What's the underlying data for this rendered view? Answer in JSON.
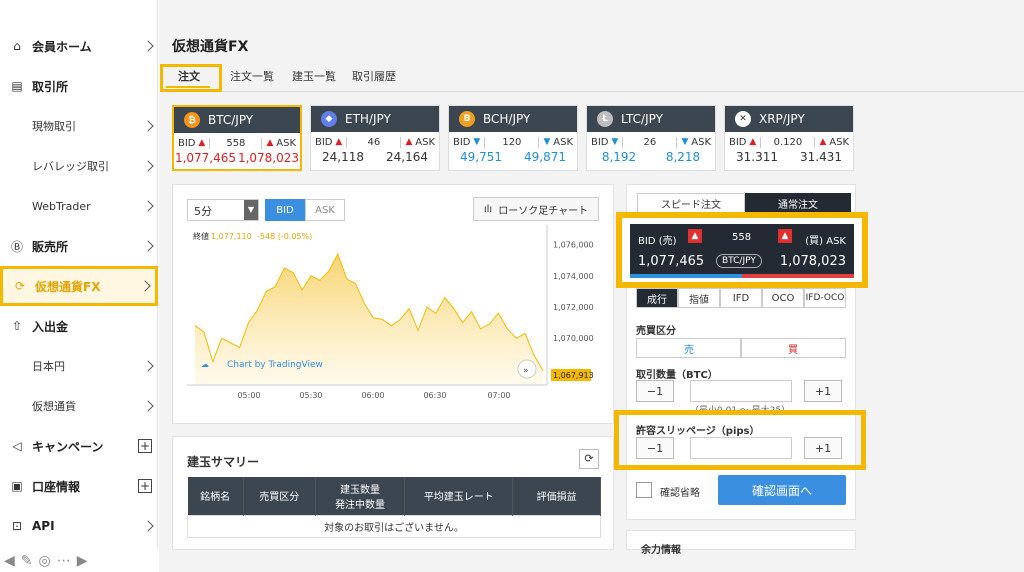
{
  "sidebar": {
    "items": [
      {
        "label": "会員ホーム",
        "icon": "home-icon",
        "glyph": "⌂",
        "control": "chevron"
      },
      {
        "label": "取引所",
        "icon": "building-icon",
        "glyph": "▤",
        "control": "none"
      },
      {
        "label": "現物取引",
        "icon": "",
        "glyph": "",
        "control": "chevron"
      },
      {
        "label": "レバレッジ取引",
        "icon": "",
        "glyph": "",
        "control": "chevron"
      },
      {
        "label": "WebTrader",
        "icon": "",
        "glyph": "",
        "control": "chevron"
      },
      {
        "label": "販売所",
        "icon": "bitcoin-icon",
        "glyph": "Ⓑ",
        "control": "chevron"
      },
      {
        "label": "仮想通貨FX",
        "icon": "exchange-icon",
        "glyph": "⟳",
        "control": "chevron"
      },
      {
        "label": "入出金",
        "icon": "deposit-icon",
        "glyph": "⇧",
        "control": "none"
      },
      {
        "label": "日本円",
        "icon": "",
        "glyph": "",
        "control": "chevron"
      },
      {
        "label": "仮想通貨",
        "icon": "",
        "glyph": "",
        "control": "chevron"
      },
      {
        "label": "キャンペーン",
        "icon": "megaphone-icon",
        "glyph": "◁",
        "control": "plus"
      },
      {
        "label": "口座情報",
        "icon": "id-card-icon",
        "glyph": "▣",
        "control": "plus"
      },
      {
        "label": "API",
        "icon": "api-icon",
        "glyph": "⊡",
        "control": "chevron"
      }
    ]
  },
  "page": {
    "title": "仮想通貨FX"
  },
  "tabs": [
    {
      "label": "注文"
    },
    {
      "label": "注文一覧"
    },
    {
      "label": "建玉一覧"
    },
    {
      "label": "取引履歴"
    }
  ],
  "pairs": [
    {
      "name": "BTC/JPY",
      "coin_color": "#f7931a",
      "coin_glyph": "₿",
      "bid_label": "BID",
      "ask_label": "ASK",
      "spread": "558",
      "bid": "1,077,465",
      "ask": "1,078,023",
      "bid_dir": "up",
      "ask_dir": "up"
    },
    {
      "name": "ETH/JPY",
      "coin_color": "#627eea",
      "coin_glyph": "◆",
      "bid_label": "BID",
      "ask_label": "ASK",
      "spread": "46",
      "bid": "24,118",
      "ask": "24,164",
      "bid_dir": "up",
      "ask_dir": "up"
    },
    {
      "name": "BCH/JPY",
      "coin_color": "#f0a020",
      "coin_glyph": "B",
      "bid_label": "BID",
      "ask_label": "ASK",
      "spread": "120",
      "bid": "49,751",
      "ask": "49,871",
      "bid_dir": "down",
      "ask_dir": "down"
    },
    {
      "name": "LTC/JPY",
      "coin_color": "#bebebe",
      "coin_glyph": "Ł",
      "bid_label": "BID",
      "ask_label": "ASK",
      "spread": "26",
      "bid": "8,192",
      "ask": "8,218",
      "bid_dir": "down",
      "ask_dir": "down"
    },
    {
      "name": "XRP/JPY",
      "coin_color": "#ffffff",
      "coin_glyph": "✕",
      "bid_label": "BID",
      "ask_label": "ASK",
      "spread": "0.120",
      "bid": "31.311",
      "ask": "31.431",
      "bid_dir": "up",
      "ask_dir": "up"
    }
  ],
  "chart_panel": {
    "interval": "5分",
    "bid_tab": "BID",
    "ask_tab": "ASK",
    "candle_button": "ローソク足チャート",
    "legend_label": "終値",
    "legend_value": "1,077,110",
    "legend_change": "-548 (-0.05%)",
    "attribution": "Chart by TradingView",
    "last_price": "1,067,913"
  },
  "chart_data": {
    "type": "area",
    "x_ticks": [
      "05:00",
      "05:30",
      "06:00",
      "06:30",
      "07:00"
    ],
    "y_ticks": [
      "1,076,000",
      "1,074,000",
      "1,072,000",
      "1,070,000"
    ],
    "ylim": [
      1067000,
      1077000
    ],
    "series": [
      {
        "values": [
          1070800,
          1070400,
          1068500,
          1070000,
          1069700,
          1069400,
          1071000,
          1071800,
          1073000,
          1073300,
          1074500,
          1074200,
          1073100,
          1074000,
          1073700,
          1074300,
          1075400,
          1073800,
          1073500,
          1072200,
          1071300,
          1071200,
          1070800,
          1071200,
          1071900,
          1070500,
          1072000,
          1071600,
          1072600,
          1071900,
          1071000,
          1071700,
          1070600,
          1070900,
          1071600,
          1070600,
          1070000,
          1070300,
          1068900,
          1067913
        ]
      }
    ],
    "color": "#f5b800",
    "grid": false
  },
  "summary": {
    "title": "建玉サマリー",
    "headers": [
      "銘柄名",
      "売買区分",
      "建玉数量\n発注中数量",
      "平均建玉レート",
      "評価損益"
    ],
    "empty_message": "対象のお取引はございません。"
  },
  "order": {
    "tabs": [
      "スピード注文",
      "通常注文"
    ],
    "quote": {
      "bid_label": "BID (売)",
      "ask_label": "(買) ASK",
      "spread": "558",
      "bid": "1,077,465",
      "ask": "1,078,023",
      "pair": "BTC/JPY"
    },
    "types": [
      "成行",
      "指値",
      "IFD",
      "OCO",
      "IFD-OCO"
    ],
    "side_label": "売買区分",
    "sell": "売",
    "buy": "買",
    "qty_label": "取引数量（BTC）",
    "qty_hint": "（最小0.01 ～ 最大25）",
    "minus": "−1",
    "plus": "+1",
    "slip_label": "許容スリッページ（pips）",
    "skip_confirm": "確認省略",
    "confirm_button": "確認画面へ",
    "info_title": "余力情報"
  },
  "colors": {
    "accent": "#f5b800",
    "dark": "#3c4651",
    "up": "#e02020",
    "down": "#1f8fd6",
    "primary": "#3a8fe0"
  }
}
